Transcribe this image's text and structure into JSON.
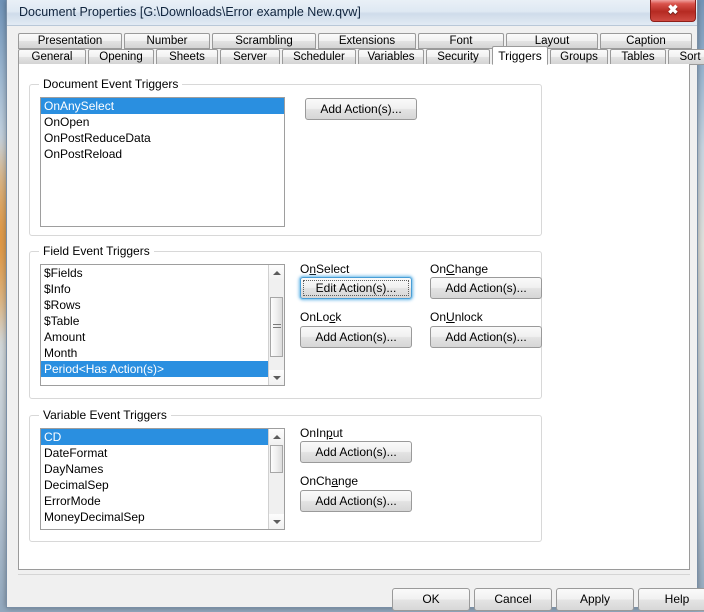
{
  "window": {
    "title": "Document Properties [G:\\Downloads\\Error example New.qvw]",
    "close_glyph": "✖"
  },
  "tabs": {
    "row1": [
      {
        "label": "Presentation",
        "active": false
      },
      {
        "label": "Number",
        "active": false
      },
      {
        "label": "Scrambling",
        "active": false
      },
      {
        "label": "Extensions",
        "active": false
      },
      {
        "label": "Font",
        "active": false
      },
      {
        "label": "Layout",
        "active": false
      },
      {
        "label": "Caption",
        "active": false
      }
    ],
    "row2": [
      {
        "label": "General",
        "active": false
      },
      {
        "label": "Opening",
        "active": false
      },
      {
        "label": "Sheets",
        "active": false
      },
      {
        "label": "Server",
        "active": false
      },
      {
        "label": "Scheduler",
        "active": false
      },
      {
        "label": "Variables",
        "active": false
      },
      {
        "label": "Security",
        "active": false
      },
      {
        "label": "Triggers",
        "active": true
      },
      {
        "label": "Groups",
        "active": false
      },
      {
        "label": "Tables",
        "active": false
      },
      {
        "label": "Sort",
        "active": false
      }
    ]
  },
  "document_event_triggers": {
    "title": "Document Event Triggers",
    "items": [
      {
        "label": "OnAnySelect",
        "selected": true
      },
      {
        "label": "OnOpen",
        "selected": false
      },
      {
        "label": "OnPostReduceData",
        "selected": false
      },
      {
        "label": "OnPostReload",
        "selected": false
      }
    ],
    "add_button": "Add Action(s)..."
  },
  "field_event_triggers": {
    "title": "Field Event Triggers",
    "items": [
      {
        "label": "$Fields",
        "selected": false
      },
      {
        "label": "$Info",
        "selected": false
      },
      {
        "label": "$Rows",
        "selected": false
      },
      {
        "label": "$Table",
        "selected": false
      },
      {
        "label": "Amount",
        "selected": false
      },
      {
        "label": "Month",
        "selected": false
      },
      {
        "label": "Period<Has Action(s)>",
        "selected": true
      }
    ],
    "onselect_label": "OnSelect",
    "onselect_button": "Edit Action(s)...",
    "onchange_label": "OnChange",
    "onchange_button": "Add Action(s)...",
    "onlock_label": "OnLock",
    "onlock_button": "Add Action(s)...",
    "onunlock_label": "OnUnlock",
    "onunlock_button": "Add Action(s)..."
  },
  "variable_event_triggers": {
    "title": "Variable Event Triggers",
    "items": [
      {
        "label": "CD",
        "selected": true
      },
      {
        "label": "DateFormat",
        "selected": false
      },
      {
        "label": "DayNames",
        "selected": false
      },
      {
        "label": "DecimalSep",
        "selected": false
      },
      {
        "label": "ErrorMode",
        "selected": false
      },
      {
        "label": "MoneyDecimalSep",
        "selected": false
      }
    ],
    "oninput_label": "OnInput",
    "oninput_button": "Add Action(s)...",
    "onchange_label": "OnChange",
    "onchange_button": "Add Action(s)..."
  },
  "footer": {
    "ok": "OK",
    "cancel": "Cancel",
    "apply": "Apply",
    "help": "Help"
  },
  "colors": {
    "selection_blue": "#2a8fe0",
    "focus_blue": "#4a9ed6",
    "close_red": "#b52a22",
    "window_face": "#f0f0f0"
  }
}
